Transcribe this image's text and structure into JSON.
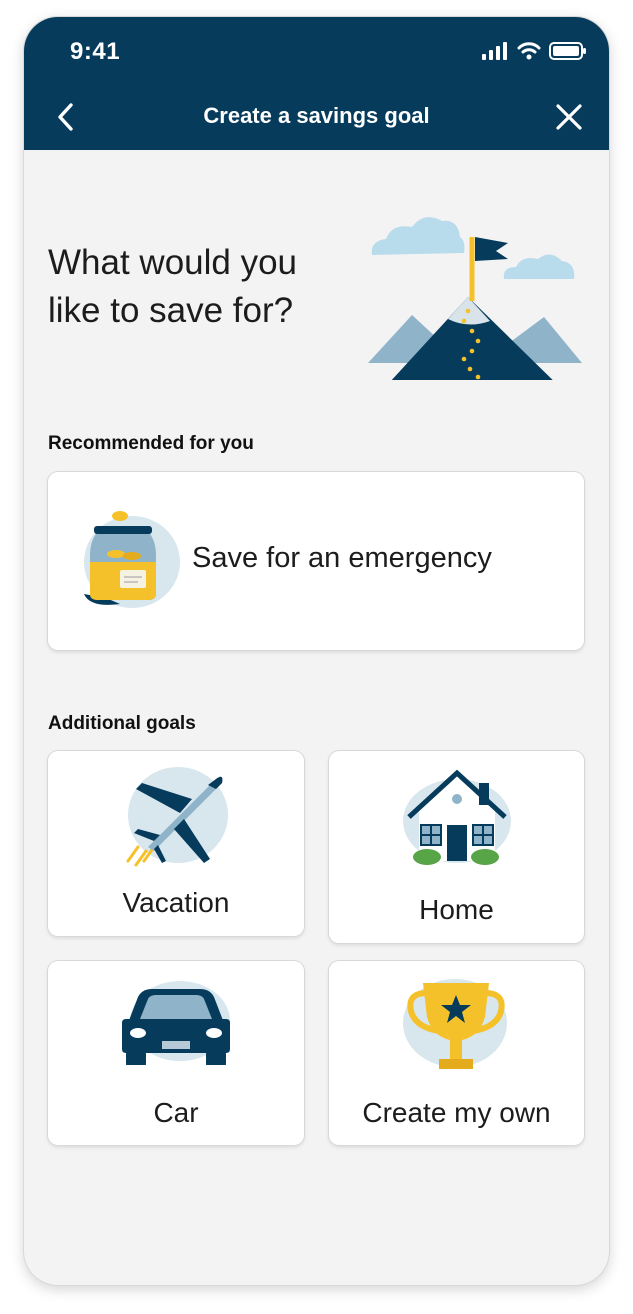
{
  "status_bar": {
    "time": "9:41"
  },
  "header": {
    "title": "Create a savings goal"
  },
  "main": {
    "headline_line1": "What would you",
    "headline_line2": "like to save for?",
    "recommended": {
      "section_label": "Recommended for you",
      "card_label": "Save for an emergency",
      "icon": "coin-jar-icon"
    },
    "additional": {
      "section_label": "Additional goals",
      "goals": [
        {
          "label": "Vacation",
          "icon": "airplane-icon"
        },
        {
          "label": "Home",
          "icon": "house-icon"
        },
        {
          "label": "Car",
          "icon": "car-icon"
        },
        {
          "label": "Create my own",
          "icon": "trophy-icon"
        }
      ]
    }
  },
  "colors": {
    "header_bg": "#063b5c",
    "accent_yellow": "#f4c12a",
    "illustration_light_blue": "#cfe3ef",
    "page_bg": "#f3f3f3"
  }
}
